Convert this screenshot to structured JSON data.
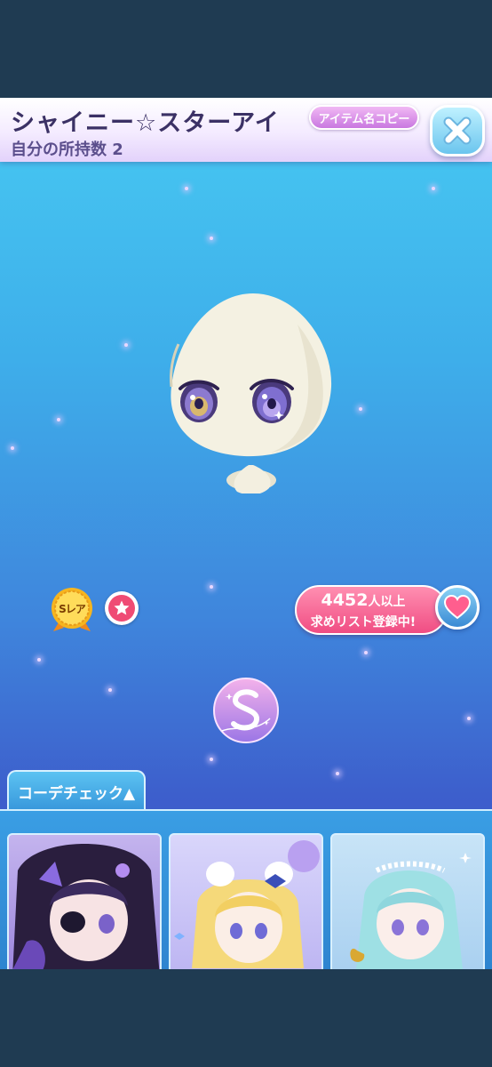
{
  "header": {
    "item_name": "シャイニー☆スターアイ",
    "owned_label": "自分の所持数",
    "owned_count": "2",
    "copy_name_label": "アイテム名コピー"
  },
  "item": {
    "rarity_label": "Sレア",
    "wish_count": "4452",
    "wish_count_suffix": "人以上",
    "wish_text": "求めリスト登録中!"
  },
  "coord_check": {
    "tab_label": "コーデチェック▲"
  },
  "icons": [
    "close-icon",
    "star-icon",
    "heart-icon",
    "stella-logo-icon",
    "rarity-medal-icon"
  ],
  "colors": {
    "accent_pink": "#f04d83",
    "title_text": "#3b3165",
    "stage_top": "#47c9f2",
    "stage_bottom": "#3b4fc2"
  }
}
